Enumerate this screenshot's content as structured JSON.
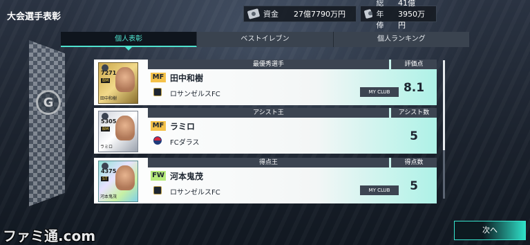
{
  "header": {
    "title": "大会選手表彰",
    "funds_label": "資金",
    "funds_value": "27億7790万円",
    "salary_label": "総年俸",
    "salary_value": "41億3950万円"
  },
  "tabs": [
    {
      "label": "個人表彰",
      "active": true
    },
    {
      "label": "ベストイレブン",
      "active": false
    },
    {
      "label": "個人ランキング",
      "active": false
    }
  ],
  "awards": [
    {
      "award_title": "最優秀選手",
      "stat_title": "評価点",
      "stat_value": "8.1",
      "position": "MF",
      "player_name": "田中和樹",
      "club_name": "ロサンゼルスFC",
      "my_club_label": "MY CLUB",
      "card": {
        "rating": "7271",
        "badge": "BM",
        "name": "田中和樹"
      }
    },
    {
      "award_title": "アシスト王",
      "stat_title": "アシスト数",
      "stat_value": "5",
      "position": "MF",
      "player_name": "ラミロ",
      "club_name": "FCダラス",
      "my_club_label": "",
      "card": {
        "rating": "5305",
        "badge": "BM",
        "name": "ラミロ"
      }
    },
    {
      "award_title": "得点王",
      "stat_title": "得点数",
      "stat_value": "5",
      "position": "FW",
      "player_name": "河本鬼茂",
      "club_name": "ロサンゼルスFC",
      "my_club_label": "MY CLUB",
      "card": {
        "rating": "4375",
        "badge": "ST",
        "name": "河本鬼茂"
      }
    }
  ],
  "next_button": "次へ",
  "watermark": "ファミ通.com",
  "colors": {
    "accent": "#4fe3cf",
    "mf": "#f5c24a",
    "fw": "#b6ea7c"
  }
}
